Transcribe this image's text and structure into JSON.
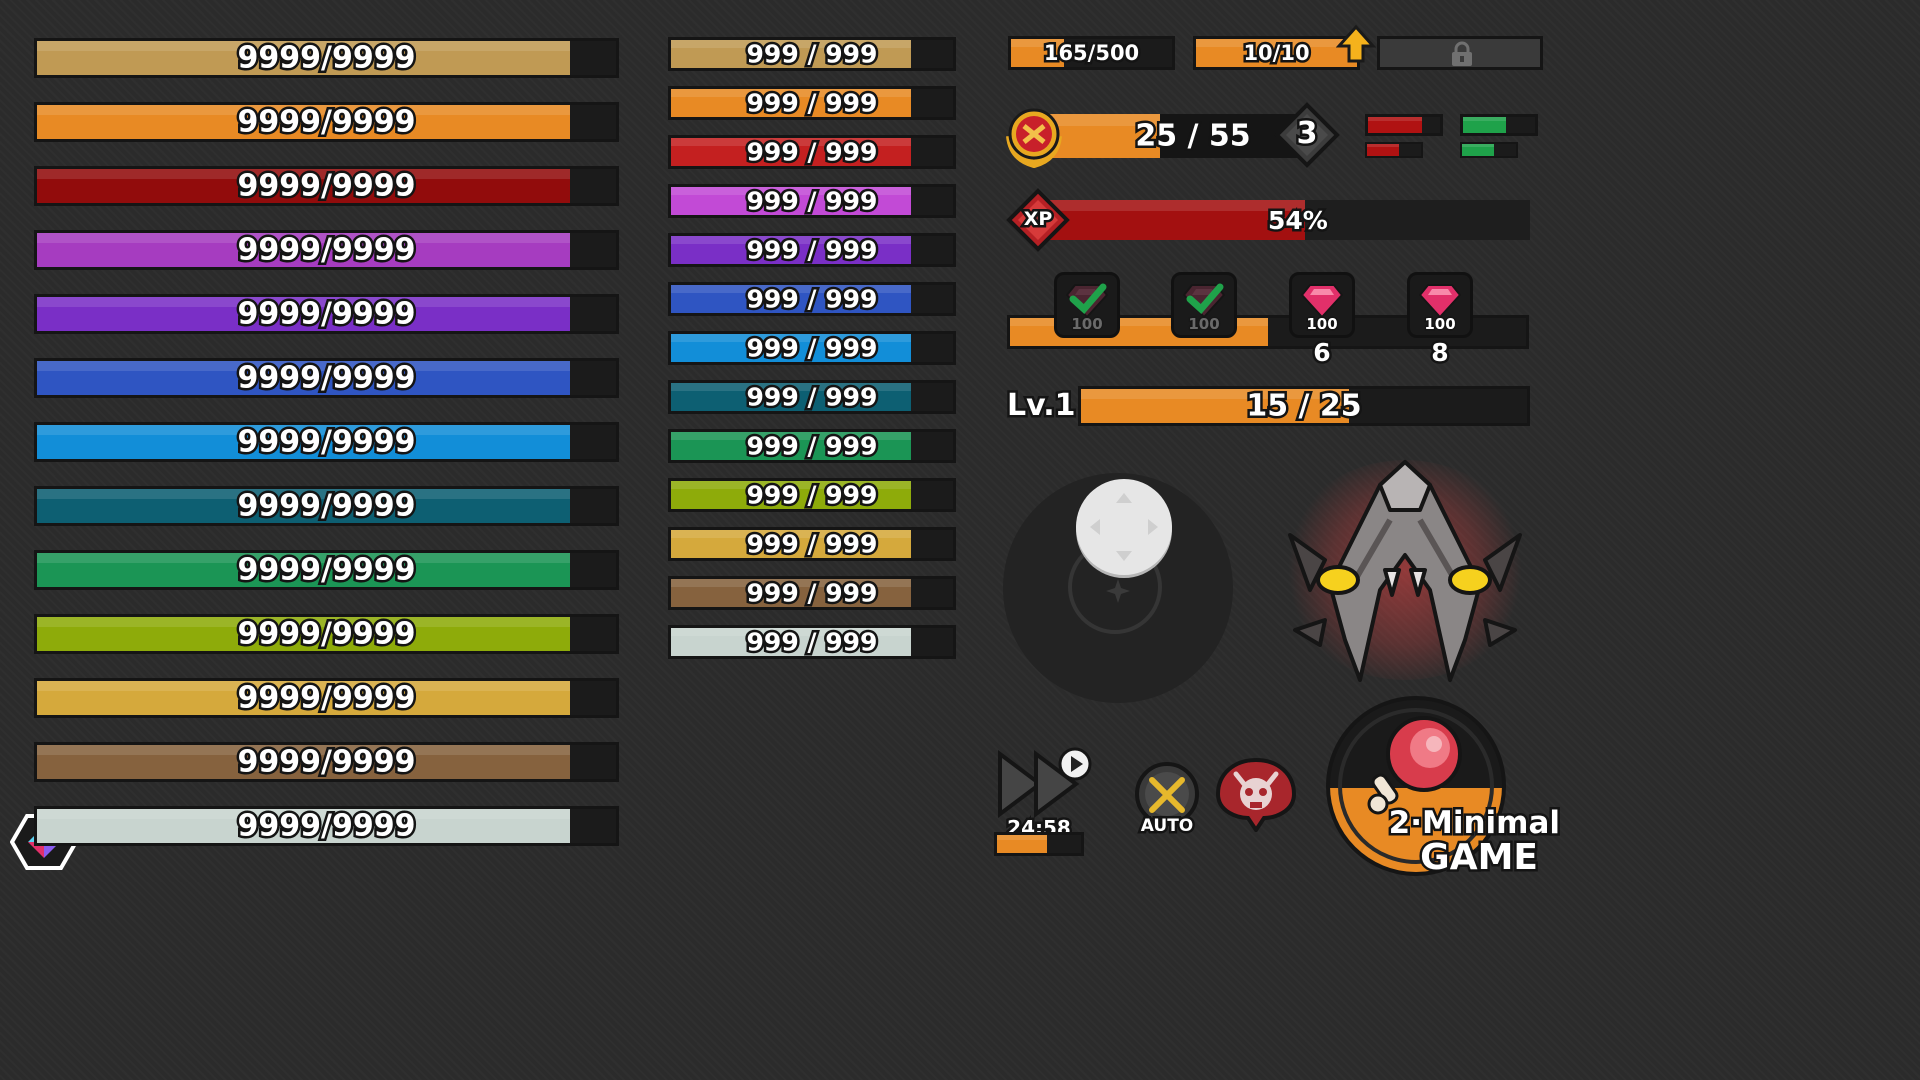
{
  "big_bars": {
    "label": "9999/9999",
    "fill_fraction": 0.92,
    "colors": [
      "#c09a54",
      "#e88a24",
      "#920c0c",
      "#a63cc0",
      "#7a2fc6",
      "#2f55c2",
      "#128ed8",
      "#0d5f72",
      "#1b9555",
      "#8eab0a",
      "#d5a93c",
      "#86623e",
      "#c8d4cf"
    ]
  },
  "small_bars": {
    "label": "999 / 999",
    "fill_fraction": 0.85,
    "colors": [
      "#c09a54",
      "#e88a24",
      "#c42020",
      "#c24ad6",
      "#7a2fc6",
      "#2f55c2",
      "#128ed8",
      "#0d5f72",
      "#1b9555",
      "#8eab0a",
      "#d5a93c",
      "#86623e",
      "#c8d4cf"
    ]
  },
  "top_bars": {
    "stamina_label": "165/500",
    "stamina_fraction": 0.33,
    "energy_label": "10/10",
    "energy_fraction": 1.0
  },
  "rank_bar": {
    "label": "25 / 55",
    "fraction": 0.45,
    "rank_number": "3"
  },
  "xp_bar": {
    "badge": "XP",
    "label": "54%",
    "fraction": 0.54
  },
  "rewards": {
    "progress_fraction": 0.5,
    "items": [
      {
        "value": "100",
        "claimed": true,
        "count": ""
      },
      {
        "value": "100",
        "claimed": true,
        "count": ""
      },
      {
        "value": "100",
        "claimed": false,
        "count": "6"
      },
      {
        "value": "100",
        "claimed": false,
        "count": "8"
      }
    ]
  },
  "level_bar": {
    "level": "Lv.1",
    "label": "15 / 25",
    "fraction": 0.6
  },
  "fast_forward": {
    "timer": "24:58",
    "fraction": 0.6
  },
  "auto_button": {
    "label": "AUTO"
  },
  "watermark": {
    "line1": "2·Minimal",
    "line2": "GAME"
  },
  "colors": {
    "orange": "#e88a24",
    "red": "#b01212",
    "green": "#1fa24a",
    "pink": "#e2306a"
  }
}
